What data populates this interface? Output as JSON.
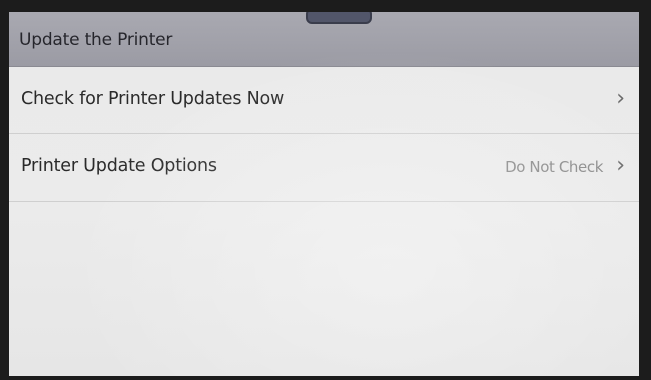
{
  "header": {
    "title": "Update the Printer"
  },
  "menu": {
    "items": [
      {
        "label": "Check for Printer Updates Now",
        "value": "",
        "chevron": "›"
      },
      {
        "label": "Printer Update Options",
        "value": "Do Not Check",
        "chevron": "›"
      }
    ]
  },
  "icons": {
    "chevron": "chevron-right-icon",
    "handle": "drawer-handle-icon"
  },
  "colors": {
    "header_bg": "#a3a3ab",
    "screen_bg": "#eaeaea",
    "label_text": "#2a2a2a",
    "value_text": "#8a8a8a"
  }
}
